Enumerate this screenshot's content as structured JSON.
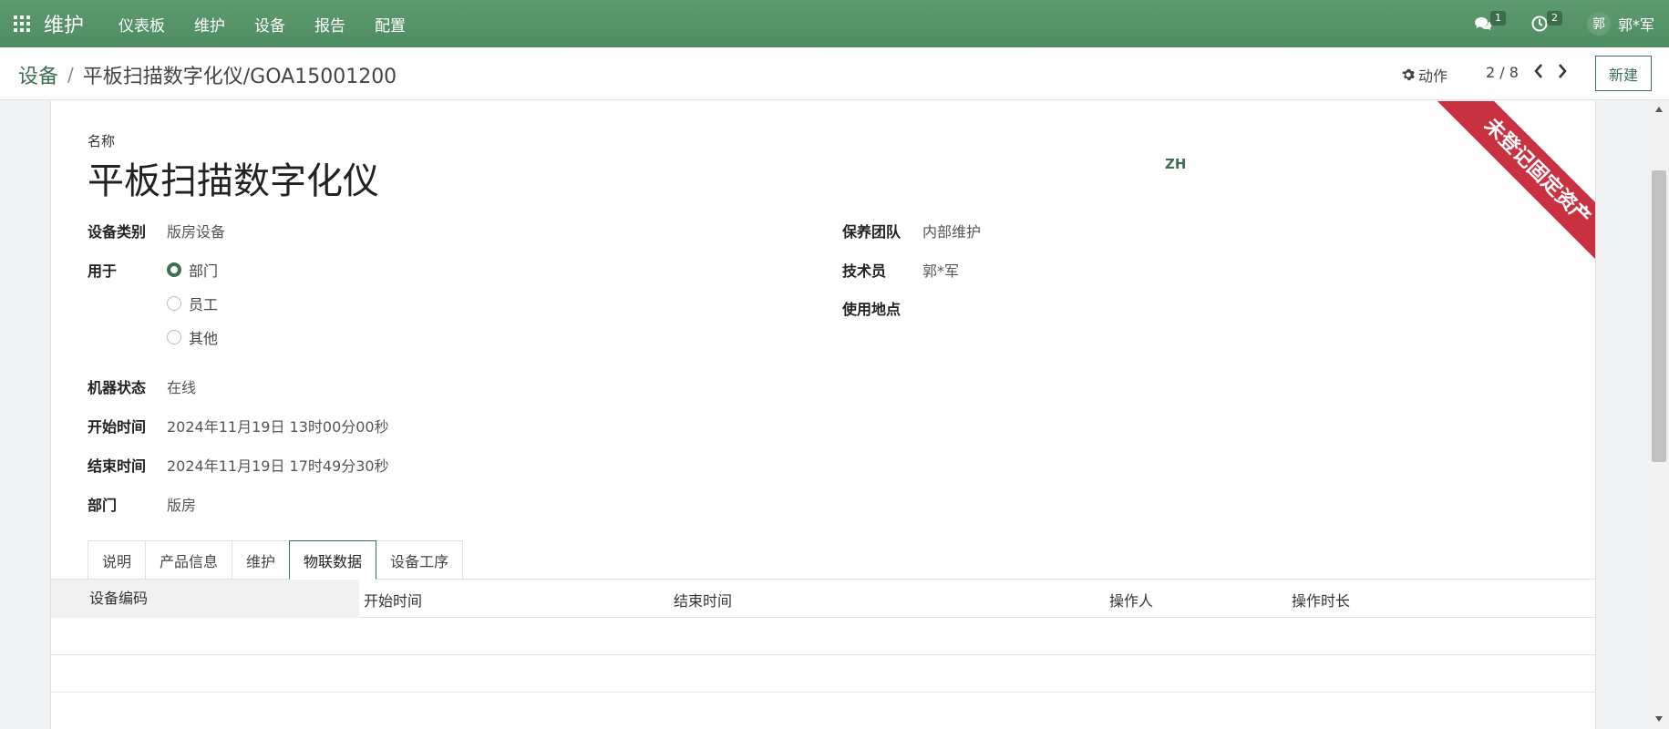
{
  "topbar": {
    "brand": "维护",
    "nav": [
      "仪表板",
      "维护",
      "设备",
      "报告",
      "配置"
    ],
    "messages_badge": "1",
    "activities_badge": "2",
    "avatar_initial": "郭",
    "username": "郭*军",
    "colors": {
      "bar": "#55935f",
      "accent": "#3f6e56"
    }
  },
  "control": {
    "breadcrumb_parent": "设备",
    "breadcrumb_current": "平板扫描数字化仪/GOA15001200",
    "action_label": "动作",
    "pager": "2 / 8",
    "new_label": "新建"
  },
  "ribbon": {
    "text": "未登记固定资产",
    "color": "#c8313f"
  },
  "form": {
    "name_label": "名称",
    "name_value": "平板扫描数字化仪",
    "lang": "ZH",
    "left_fields": {
      "category_label": "设备类别",
      "category_value": "版房设备",
      "used_for_label": "用于",
      "used_for_options": [
        "部门",
        "员工",
        "其他"
      ],
      "used_for_selected": "部门",
      "status_label": "机器状态",
      "status_value": "在线",
      "start_label": "开始时间",
      "start_value": "2024年11月19日 13时00分00秒",
      "end_label": "结束时间",
      "end_value": "2024年11月19日 17时49分30秒",
      "dept_label": "部门",
      "dept_value": "版房"
    },
    "right_fields": {
      "team_label": "保养团队",
      "team_value": "内部维护",
      "tech_label": "技术员",
      "tech_value": "郭*军",
      "location_label": "使用地点"
    }
  },
  "tabs": [
    "说明",
    "产品信息",
    "维护",
    "物联数据",
    "设备工序"
  ],
  "active_tab": "物联数据",
  "table": {
    "columns": [
      "设备编码",
      "开始时间",
      "结束时间",
      "操作人",
      "操作时长"
    ]
  }
}
